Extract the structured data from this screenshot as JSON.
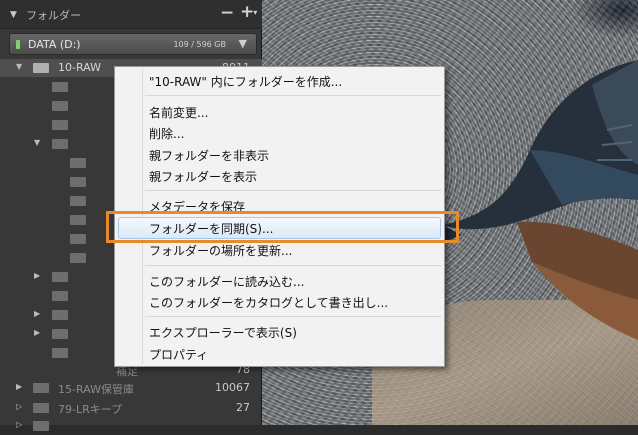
{
  "panel": {
    "title": "フォルダー",
    "minus": "−",
    "plus": "+",
    "volume": {
      "name": "DATA (D:)",
      "size": "109 / 596 GB"
    },
    "current_folder": {
      "name": "10-RAW",
      "count": "8011"
    },
    "partial_rows": [
      {
        "label": "補足",
        "count": "78"
      },
      {
        "label": "15-RAW保管庫",
        "count": "10067"
      },
      {
        "label": "79-LRキープ",
        "count": "27"
      }
    ]
  },
  "menu": {
    "items": [
      "\"10-RAW\" 内にフォルダーを作成...",
      "名前変更...",
      "削除...",
      "親フォルダーを非表示",
      "親フォルダーを表示",
      "メタデータを保存",
      "フォルダーを同期(S)...",
      "フォルダーの場所を更新...",
      "このフォルダーに読み込む...",
      "このフォルダーをカタログとして書き出し...",
      "エクスプローラーで表示(S)",
      "プロパティ"
    ],
    "highlighted": "フォルダーを同期(S)..."
  },
  "colors": {
    "highlight_border": "#e8892a",
    "panel_bg": "#383838"
  }
}
